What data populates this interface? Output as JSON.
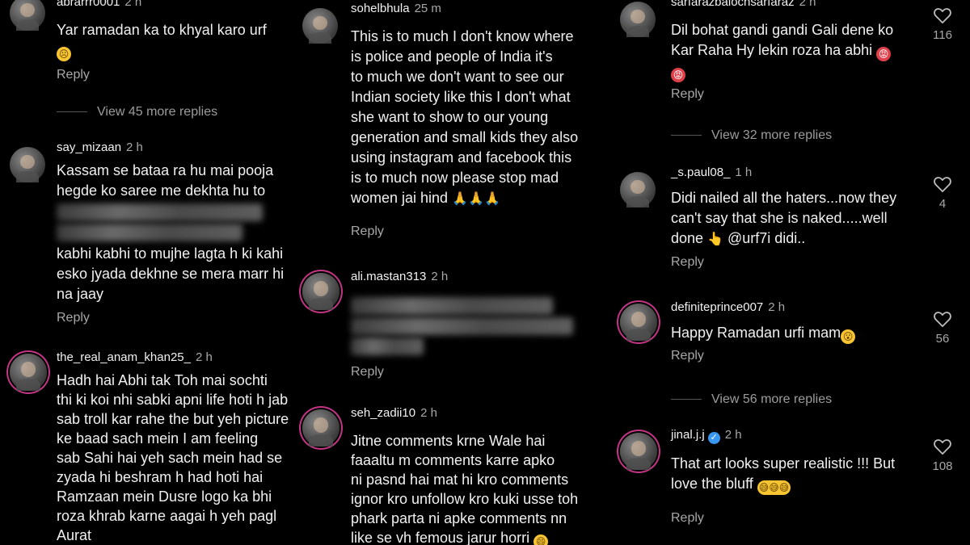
{
  "col1": {
    "c1": {
      "username": "abrarrr0001",
      "time": "2 h",
      "text": "Yar ramadan ka to khyal karo urf",
      "emoji": "☹",
      "reply": "Reply"
    },
    "more1": "View 45 more replies",
    "c2": {
      "username": "say_mizaan",
      "time": "2 h",
      "lines": [
        "Kassam se bataa ra hu mai pooja",
        "hegde ko saree me dekhta hu to"
      ],
      "lines_after": [
        "kabhi kabhi to mujhe lagta h ki kahi",
        "esko jyada dekhne se mera marr hi",
        "na jaay"
      ],
      "reply": "Reply"
    },
    "c3": {
      "username": "the_real_anam_khan25_",
      "time": "2 h",
      "lines": [
        "Hadh hai Abhi tak Toh mai sochti",
        "thi ki koi nhi sabki apni life hoti h jab",
        "sab troll kar rahe the but yeh picture",
        "ke baad sach mein I am feeling",
        "sab Sahi hai yeh sach mein had se",
        "zyada hi beshram h had hoti hai",
        "Ramzaan mein Dusre logo ka bhi",
        "roza khrab karne aagai h yeh pagl",
        "Aurat"
      ]
    }
  },
  "col2": {
    "c1": {
      "username": "sohelbhula",
      "time": "25 m",
      "lines": [
        "This is to much I don't know where",
        "is police and people of India it's",
        "to much we don't want to see our",
        "Indian society like this I don't what",
        "she want to show to our young",
        "generation and small kids they also",
        "using instagram and facebook this",
        "is to much now please stop mad",
        "women jai hind"
      ],
      "emoji": "🙏🙏🙏",
      "reply": "Reply"
    },
    "c2": {
      "username": "ali.mastan313",
      "time": "2 h",
      "reply": "Reply"
    },
    "c3": {
      "username": "seh_zadii10",
      "time": "2 h",
      "lines": [
        "Jitne comments krne Wale hai",
        "faaaltu m comments karre apko",
        "ni pasnd hai mat hi kro comments",
        "ignor kro unfollow kro kuki usse toh",
        "phark parta ni apke comments nn",
        "like se vh femous jarur horri"
      ],
      "emoji": "😄"
    }
  },
  "col3": {
    "c1": {
      "username": "sarfarazbalochsarfaraz",
      "time": "2 h",
      "lines": [
        "Dil bohat gandi gandi Gali dene ko",
        "Kar Raha Hy lekin roza ha abhi"
      ],
      "emoji": "😡",
      "reply": "Reply",
      "likes": "116"
    },
    "more1": "View 32 more replies",
    "c2": {
      "username": "_s.paul08_",
      "time": "1 h",
      "lines": [
        "Didi nailed all the haters...now they",
        "can't say that she is naked.....well"
      ],
      "line3": "done",
      "emoji": "👆",
      "mention": "@urf7i didi..",
      "reply": "Reply",
      "likes": "4"
    },
    "c3": {
      "username": "definiteprince007",
      "time": "2 h",
      "text": "Happy Ramadan urfi mam",
      "emoji": "😮",
      "reply": "Reply",
      "likes": "56"
    },
    "more2": "View 56 more replies",
    "c4": {
      "username": "jinal.j.j",
      "time": "2 h",
      "lines": [
        "That art looks super realistic !!! But",
        "love the bluff"
      ],
      "emoji": "😅😅😅",
      "reply": "Reply",
      "likes": "108"
    }
  },
  "colors": {
    "background": "#000000",
    "muted": "#a8a8a8",
    "story_ring": "#c13584",
    "verified": "#3897f0"
  },
  "icons": [
    "heart-icon",
    "verified-badge-icon"
  ]
}
